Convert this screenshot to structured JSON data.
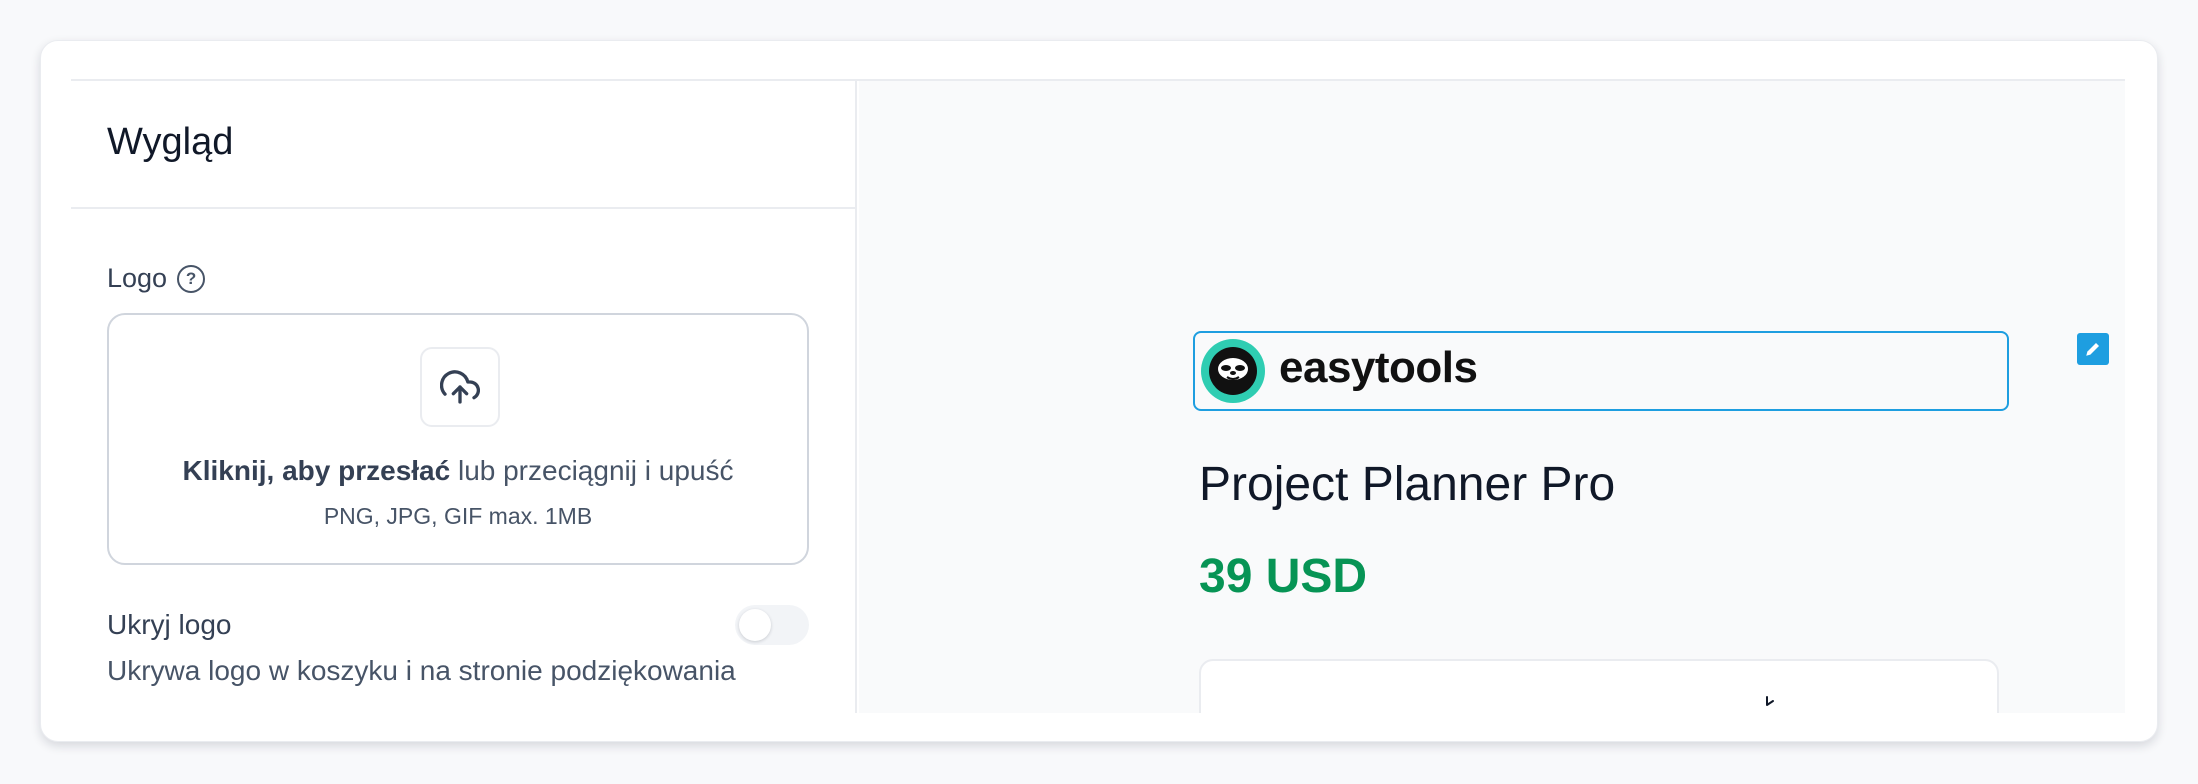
{
  "section": {
    "title": "Wygląd"
  },
  "logo": {
    "label": "Logo",
    "help_symbol": "?",
    "upload": {
      "click_text": "Kliknij, aby przesłać",
      "drag_text": "lub przeciągnij i upuść",
      "formats": "PNG, JPG, GIF max. 1MB",
      "icon": "upload-cloud-icon"
    }
  },
  "hide_logo": {
    "label": "Ukryj logo",
    "description": "Ukrywa logo w koszyku i na stronie podziękowania",
    "enabled": false
  },
  "preview": {
    "brand_name": "easytools",
    "product_title": "Project Planner Pro",
    "price": "39 USD",
    "accent_color": "#1e9ee0",
    "price_color": "#079455"
  }
}
